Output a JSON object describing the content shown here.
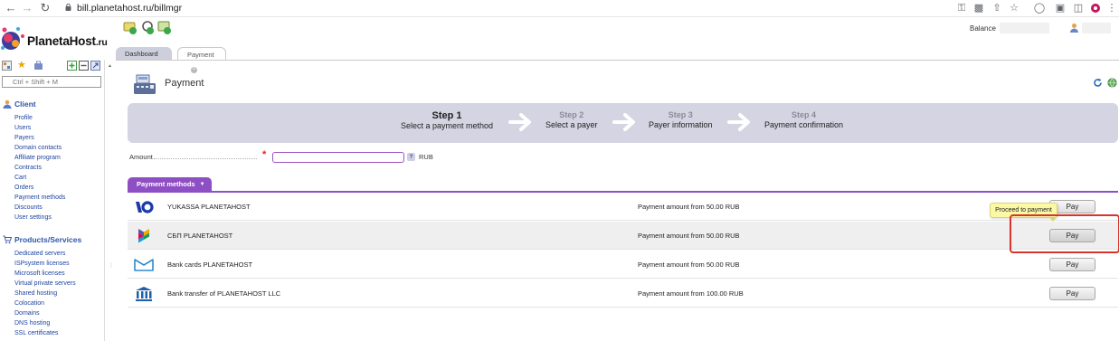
{
  "browser": {
    "url": "bill.planetahost.ru/billmgr"
  },
  "header": {
    "logo_text": "PlanetaHost",
    "logo_tld": ".ru",
    "balance_label": "Balance"
  },
  "tabs": [
    {
      "label": "Dashboard"
    },
    {
      "label": "Payment"
    }
  ],
  "sidebar": {
    "search_placeholder": "Ctrl + Shift + M",
    "client": {
      "title": "Client",
      "items": [
        "Profile",
        "Users",
        "Payers",
        "Domain contacts",
        "Affiliate program",
        "Contracts",
        "Cart",
        "Orders",
        "Payment methods",
        "Discounts",
        "User settings"
      ]
    },
    "products": {
      "title": "Products/Services",
      "items": [
        "Dedicated servers",
        "ISPsystem licenses",
        "Microsoft licenses",
        "Virtual private servers",
        "Shared hosting",
        "Colocation",
        "Domains",
        "DNS hosting",
        "SSL certificates"
      ]
    }
  },
  "page": {
    "title": "Payment"
  },
  "wizard": {
    "steps": [
      {
        "num": "Step 1",
        "name": "Select a payment method",
        "active": true
      },
      {
        "num": "Step 2",
        "name": "Select a payer",
        "active": false
      },
      {
        "num": "Step 3",
        "name": "Payer information",
        "active": false
      },
      {
        "num": "Step 4",
        "name": "Payment confirmation",
        "active": false
      }
    ]
  },
  "amount": {
    "label": "Amount",
    "value": "",
    "help": "?",
    "currency": "RUB"
  },
  "payment_methods": {
    "tab_label": "Payment methods",
    "pay_label": "Pay",
    "tooltip": "Proceed to payment",
    "rows": [
      {
        "name": "YUKASSA PLANETAHOST",
        "amount": "Payment amount from 50.00 RUB",
        "logo": "yukassa-logo"
      },
      {
        "name": "СБП PLANETAHOST",
        "amount": "Payment amount from 50.00 RUB",
        "logo": "sbp-logo"
      },
      {
        "name": "Bank cards PLANETAHOST",
        "amount": "Payment amount from 50.00 RUB",
        "logo": "bank-card-logo"
      },
      {
        "name": "Bank transfer of PLANETAHOST LLC",
        "amount": "Payment amount from 100.00 RUB",
        "logo": "bank-transfer-logo"
      }
    ]
  },
  "colors": {
    "accent_purple": "#8f4fc4",
    "link_blue": "#1e45a1",
    "highlight_red": "#d6342c",
    "tooltip_yellow": "#fbf8a6"
  }
}
